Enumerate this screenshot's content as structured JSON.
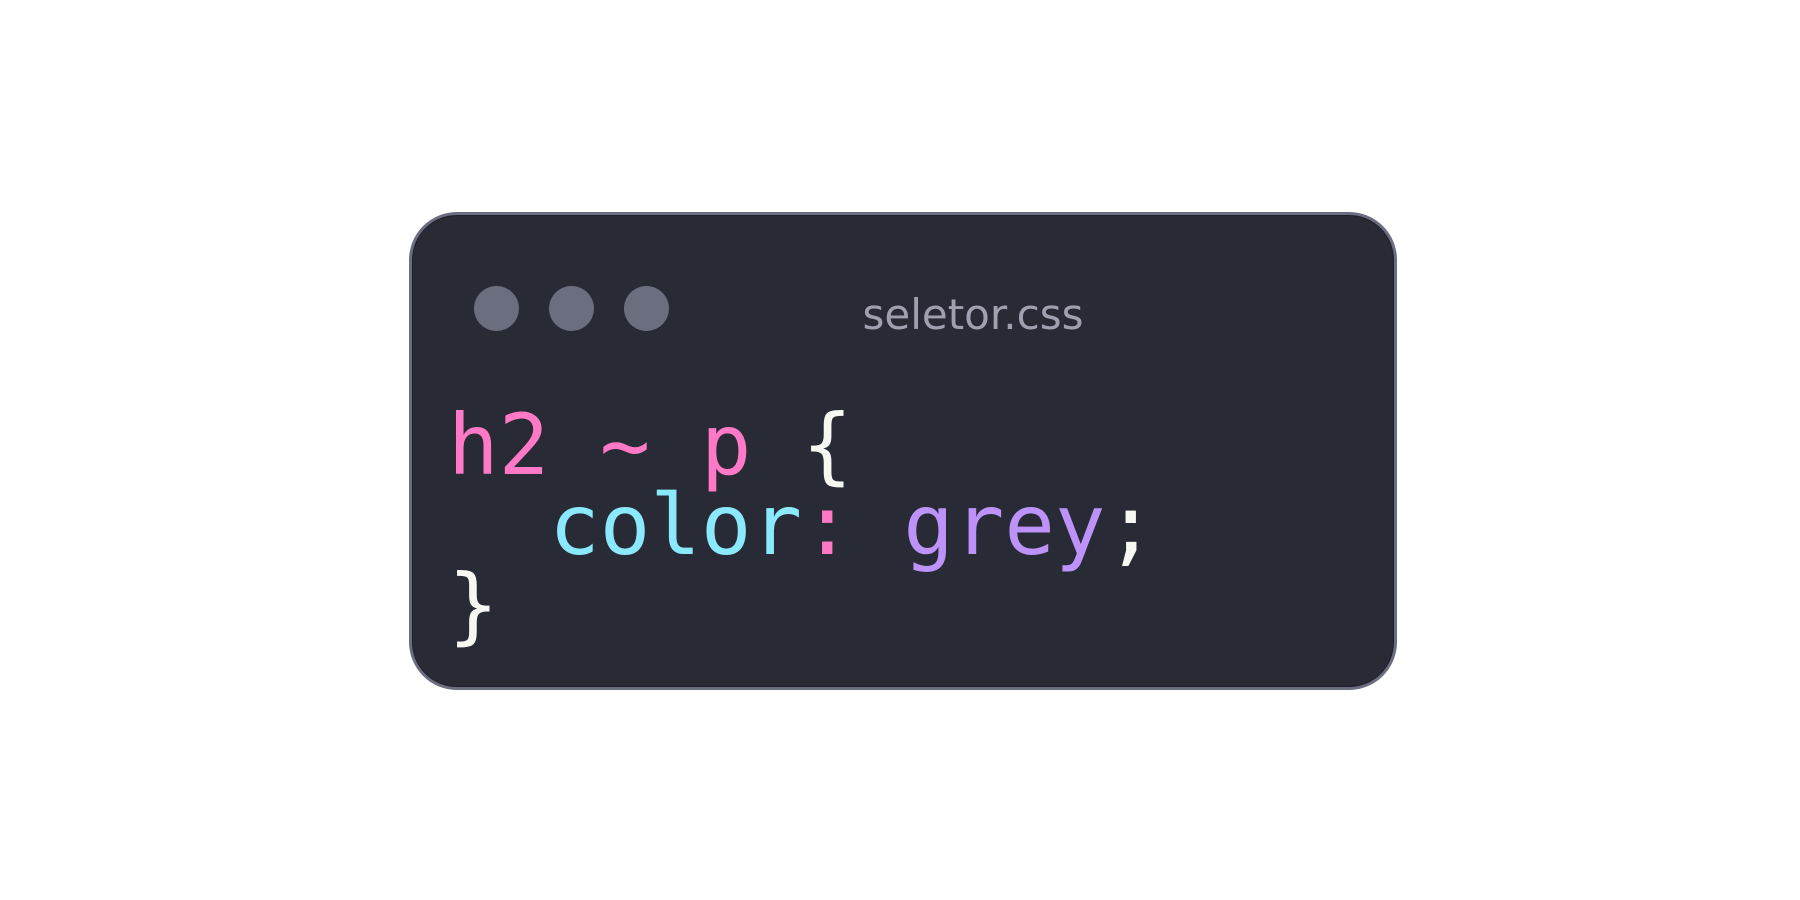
{
  "window": {
    "filename": "seletor.css"
  },
  "code": {
    "lines": [
      [
        {
          "text": "h2",
          "color": "#ff79c6"
        },
        {
          "text": " ",
          "color": "#f8f8f2"
        },
        {
          "text": "~",
          "color": "#ff79c6"
        },
        {
          "text": " ",
          "color": "#f8f8f2"
        },
        {
          "text": "p",
          "color": "#ff79c6"
        },
        {
          "text": " ",
          "color": "#f8f8f2"
        },
        {
          "text": "{",
          "color": "#f8f8f2"
        }
      ],
      [
        {
          "text": "  ",
          "color": "#f8f8f2"
        },
        {
          "text": "color",
          "color": "#8be9fd"
        },
        {
          "text": ":",
          "color": "#ff79c6"
        },
        {
          "text": " ",
          "color": "#f8f8f2"
        },
        {
          "text": "grey",
          "color": "#bd93f9"
        },
        {
          "text": ";",
          "color": "#f8f8f2"
        }
      ],
      [
        {
          "text": "}",
          "color": "#f8f8f2"
        }
      ]
    ]
  },
  "colors": {
    "background": "#282a36",
    "border": "#6b6d80",
    "dot": "#6b6e7e",
    "filename": "#9fa1b0"
  }
}
